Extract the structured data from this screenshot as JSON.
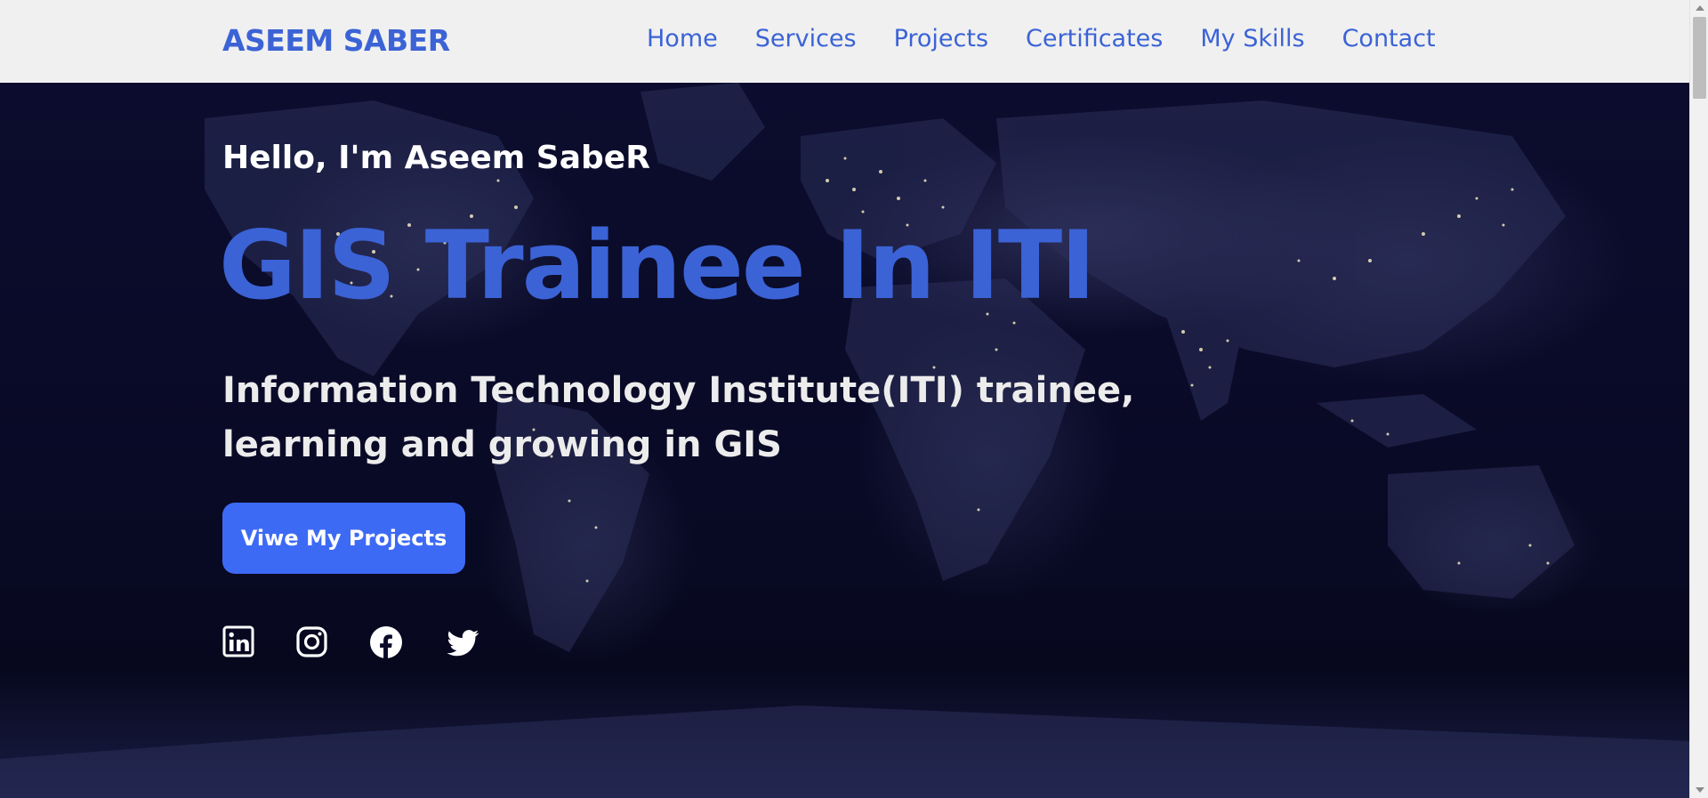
{
  "nav": {
    "brand": "ASEEM SABER",
    "links": [
      "Home",
      "Services",
      "Projects",
      "Certificates",
      "My Skills",
      "Contact"
    ]
  },
  "hero": {
    "greeting": "Hello, I'm Aseem SabeR",
    "headline": "GIS Trainee In ITI",
    "subtitle": "Information Technology Institute(ITI) trainee, learning and growing in GIS",
    "cta_label": "Viwe My Projects",
    "socials": [
      "linkedin-icon",
      "instagram-icon",
      "facebook-icon",
      "twitter-icon"
    ]
  },
  "colors": {
    "accent": "#3b63d6",
    "button": "#3d6af5",
    "navbar_bg": "#f0f0f0",
    "hero_bg": "#0a0b28",
    "city_lights": "#fff6c8"
  }
}
